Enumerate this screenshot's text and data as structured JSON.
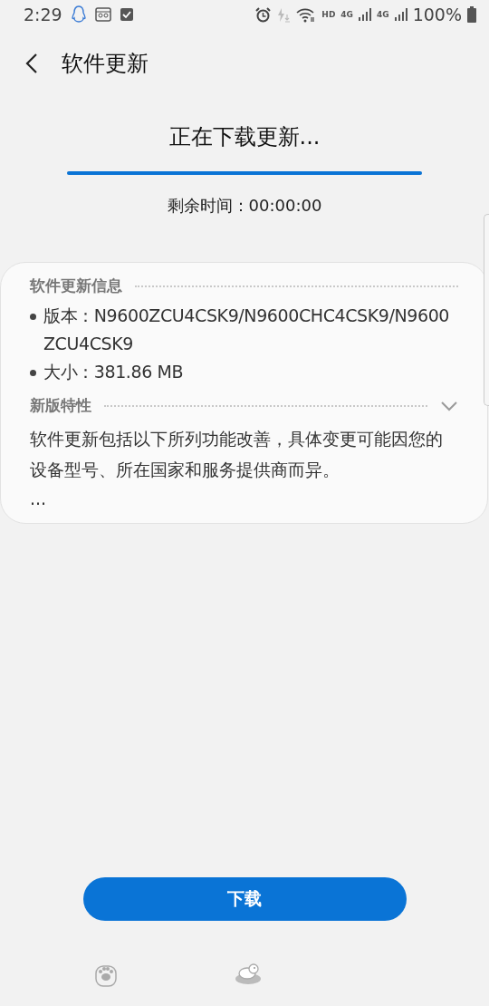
{
  "status_bar": {
    "time": "2:29",
    "hd": "HD",
    "network_labels": [
      "4G",
      "4G"
    ],
    "battery": "100%"
  },
  "header": {
    "title": "软件更新"
  },
  "download": {
    "status": "正在下载更新...",
    "level": 1,
    "remaining": "剩余时间：00:00:00"
  },
  "info_card": {
    "section_title": "软件更新信息",
    "items": [
      "版本：N9600ZCU4CSK9/N9600CHC4CSK9/N9600ZCU4CSK9",
      "大小：381.86 MB"
    ],
    "features": {
      "title": "新版特性",
      "expanded": false,
      "text": "软件更新包括以下所列功能改善，具体变更可能因您的设备型号、所在国家和服务提供商而异。",
      "more": "..."
    }
  },
  "button": {
    "label": "下载"
  }
}
